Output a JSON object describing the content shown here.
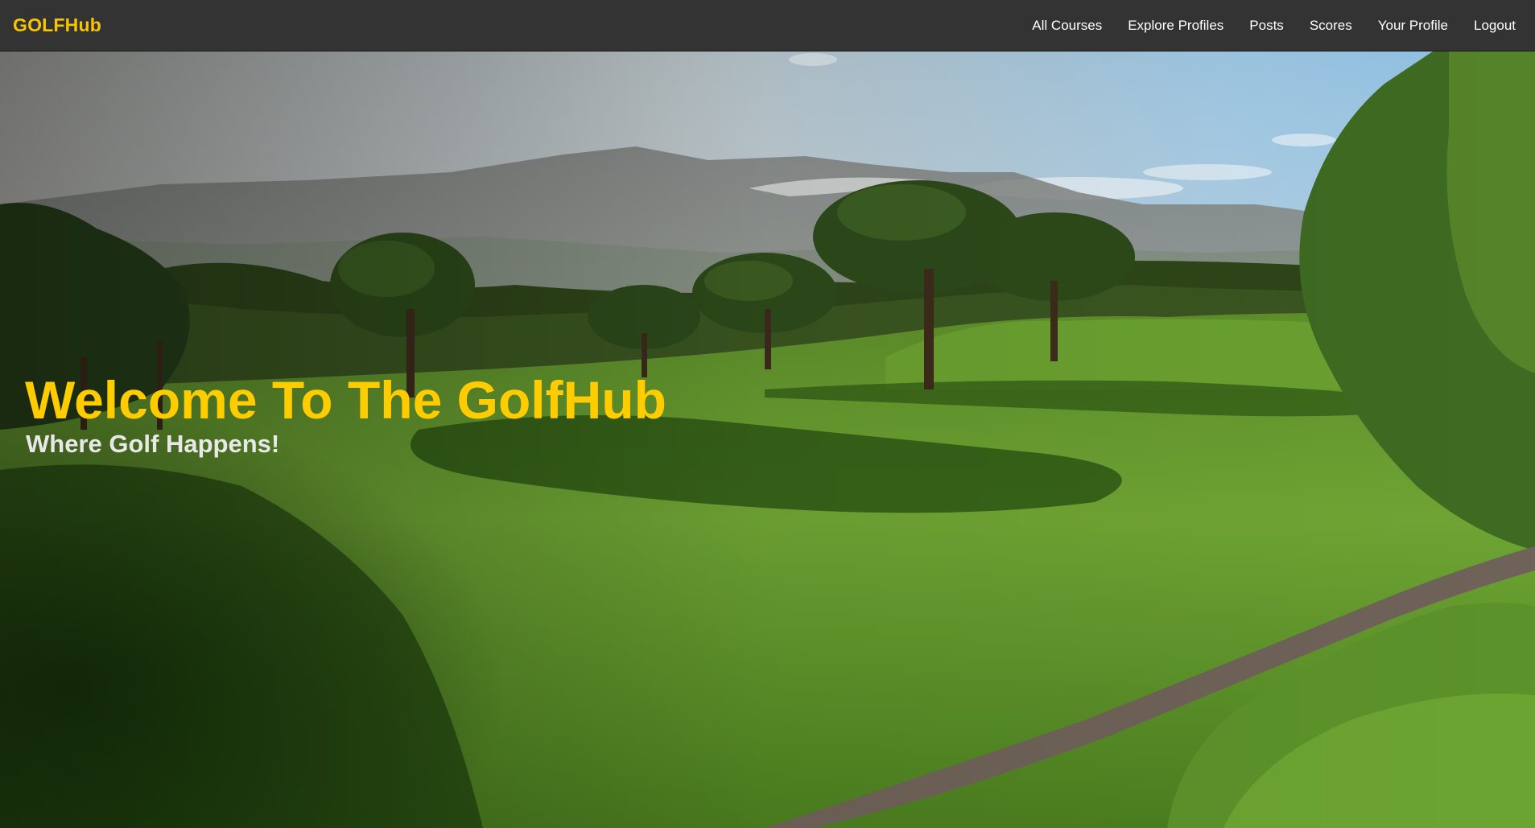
{
  "app": {
    "brand": "GOLFHub"
  },
  "nav": {
    "items": [
      {
        "label": "All Courses"
      },
      {
        "label": "Explore Profiles"
      },
      {
        "label": "Posts"
      },
      {
        "label": "Scores"
      },
      {
        "label": "Your Profile"
      },
      {
        "label": "Logout"
      }
    ]
  },
  "hero": {
    "title": "Welcome To The GolfHub",
    "subtitle": "Where Golf Happens!",
    "background_image": "golf-course-landscape"
  },
  "colors": {
    "navbar_bg": "#333333",
    "brand": "#f7c600",
    "hero_title": "#ffcc00",
    "hero_subtitle": "#e8e8e8",
    "nav_text": "#ffffff"
  }
}
